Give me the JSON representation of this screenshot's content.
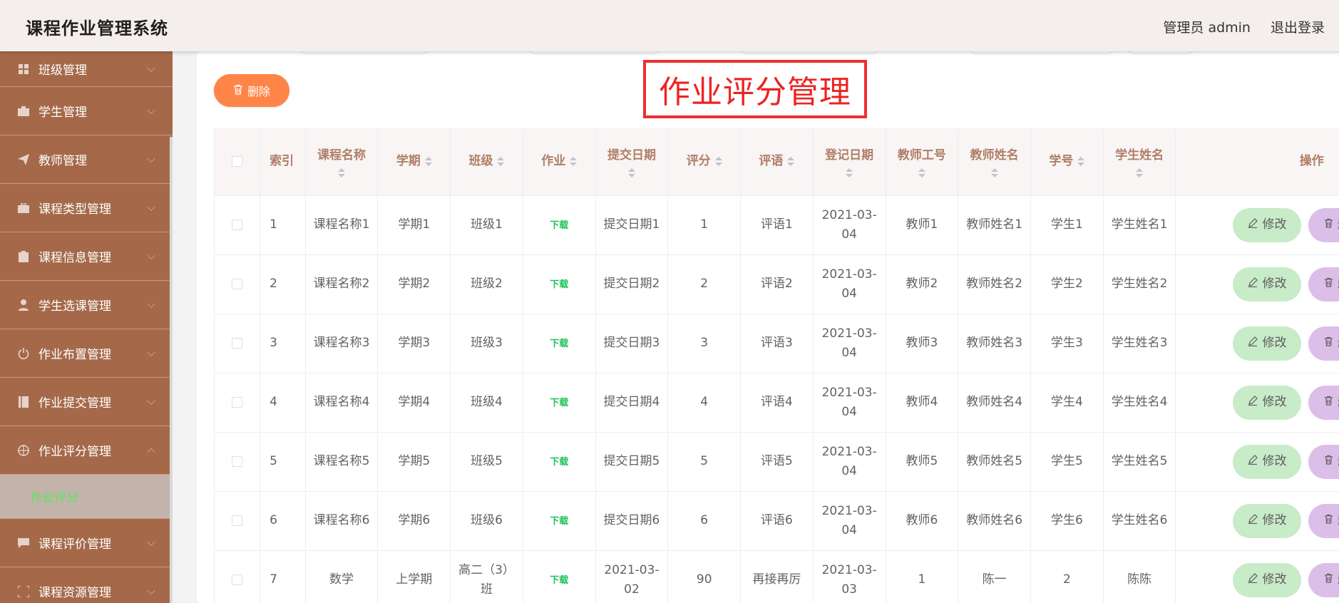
{
  "header": {
    "app_title": "课程作业管理系统",
    "user_label": "管理员 admin",
    "logout_label": "退出登录"
  },
  "sidebar": {
    "items": [
      {
        "label": "班级管理",
        "icon": "grid-icon"
      },
      {
        "label": "学生管理",
        "icon": "card-icon"
      },
      {
        "label": "教师管理",
        "icon": "send-icon"
      },
      {
        "label": "课程类型管理",
        "icon": "briefcase-icon"
      },
      {
        "label": "课程信息管理",
        "icon": "clipboard-icon"
      },
      {
        "label": "学生选课管理",
        "icon": "user-icon"
      },
      {
        "label": "作业布置管理",
        "icon": "power-icon"
      },
      {
        "label": "作业提交管理",
        "icon": "book-icon"
      },
      {
        "label": "作业评分管理",
        "icon": "target-icon",
        "expanded": true
      },
      {
        "label": "课程评价管理",
        "icon": "chat-icon"
      },
      {
        "label": "课程资源管理",
        "icon": "frame-icon"
      }
    ],
    "active_sub_item": "作业评分"
  },
  "main": {
    "page_title": "作业评分管理",
    "bulk_delete_label": "删除"
  },
  "table": {
    "columns": [
      "索引",
      "课程名称",
      "学期",
      "班级",
      "作业",
      "提交日期",
      "评分",
      "评语",
      "登记日期",
      "教师工号",
      "教师姓名",
      "学号",
      "学生姓名",
      "操作"
    ],
    "edit_label": "修改",
    "delete_label": "删除",
    "download_label": "下载",
    "rows": [
      {
        "idx": "1",
        "course": "课程名称1",
        "term": "学期1",
        "cls": "班级1",
        "submit": "提交日期1",
        "score": "1",
        "comment": "评语1",
        "reg": "2021-03-04",
        "tid": "教师1",
        "tname": "教师姓名1",
        "sid": "学生1",
        "sname": "学生姓名1"
      },
      {
        "idx": "2",
        "course": "课程名称2",
        "term": "学期2",
        "cls": "班级2",
        "submit": "提交日期2",
        "score": "2",
        "comment": "评语2",
        "reg": "2021-03-04",
        "tid": "教师2",
        "tname": "教师姓名2",
        "sid": "学生2",
        "sname": "学生姓名2"
      },
      {
        "idx": "3",
        "course": "课程名称3",
        "term": "学期3",
        "cls": "班级3",
        "submit": "提交日期3",
        "score": "3",
        "comment": "评语3",
        "reg": "2021-03-04",
        "tid": "教师3",
        "tname": "教师姓名3",
        "sid": "学生3",
        "sname": "学生姓名3"
      },
      {
        "idx": "4",
        "course": "课程名称4",
        "term": "学期4",
        "cls": "班级4",
        "submit": "提交日期4",
        "score": "4",
        "comment": "评语4",
        "reg": "2021-03-04",
        "tid": "教师4",
        "tname": "教师姓名4",
        "sid": "学生4",
        "sname": "学生姓名4"
      },
      {
        "idx": "5",
        "course": "课程名称5",
        "term": "学期5",
        "cls": "班级5",
        "submit": "提交日期5",
        "score": "5",
        "comment": "评语5",
        "reg": "2021-03-04",
        "tid": "教师5",
        "tname": "教师姓名5",
        "sid": "学生5",
        "sname": "学生姓名5"
      },
      {
        "idx": "6",
        "course": "课程名称6",
        "term": "学期6",
        "cls": "班级6",
        "submit": "提交日期6",
        "score": "6",
        "comment": "评语6",
        "reg": "2021-03-04",
        "tid": "教师6",
        "tname": "教师姓名6",
        "sid": "学生6",
        "sname": "学生姓名6"
      },
      {
        "idx": "7",
        "course": "数学",
        "term": "上学期",
        "cls": "高二（3）班",
        "submit": "2021-03-02",
        "score": "90",
        "comment": "再接再厉",
        "reg": "2021-03-03",
        "tid": "1",
        "tname": "陈一",
        "sid": "2",
        "sname": "陈陈"
      }
    ]
  },
  "colors": {
    "header_bg": "#f4eeec",
    "sidebar_bg": "#a5694a",
    "title_red": "#ec2323",
    "delete_orange": "#ff8447",
    "edit_green": "#c8ebc8",
    "delete_purple": "#dcbfe8",
    "active_green": "#57e85a",
    "header_text": "#b07e67"
  }
}
